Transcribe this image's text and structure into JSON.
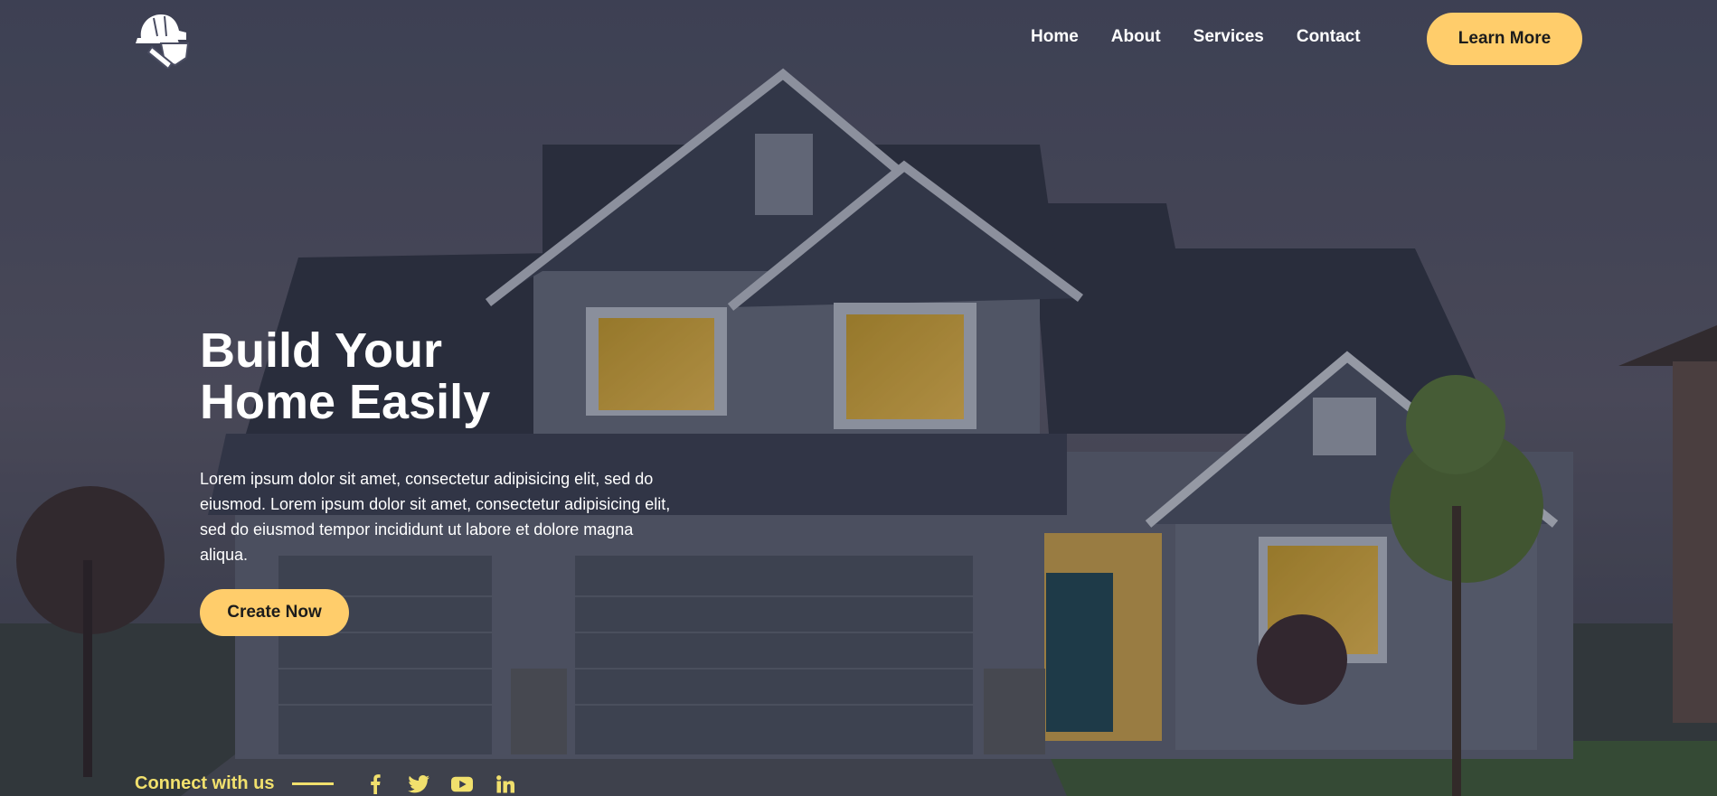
{
  "nav": {
    "items": [
      {
        "label": "Home"
      },
      {
        "label": "About"
      },
      {
        "label": "Services"
      },
      {
        "label": "Contact"
      }
    ],
    "cta_label": "Learn More"
  },
  "hero": {
    "title_line1": "Build Your",
    "title_line2": "Home Easily",
    "description": "Lorem ipsum dolor sit amet, consectetur adipisicing elit, sed do eiusmod. Lorem ipsum dolor sit amet, consectetur adipisicing elit, sed do eiusmod tempor incididunt ut labore et dolore magna aliqua.",
    "cta_label": "Create Now"
  },
  "social": {
    "label": "Connect with us",
    "icons": [
      "facebook-icon",
      "twitter-icon",
      "youtube-icon",
      "linkedin-icon"
    ]
  },
  "colors": {
    "accent": "#ffcd6b",
    "social_accent": "#f1e06d",
    "text": "#ffffff"
  }
}
